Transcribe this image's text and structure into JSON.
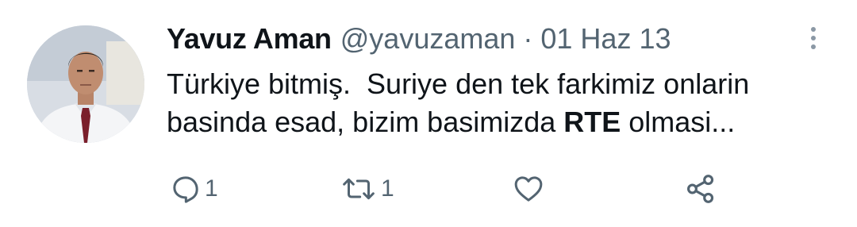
{
  "tweet": {
    "author": {
      "display_name": "Yavuz Aman",
      "handle": "@yavuzaman"
    },
    "separator": "·",
    "date": "01 Haz 13",
    "text": {
      "line1": "Türkiye bitmiş.  Suriye den tek farkimiz onlarin",
      "line2_before": "basinda esad, bizim basimizda ",
      "line2_bold": "RTE",
      "line2_after": " olmasi..."
    },
    "actions": {
      "reply": {
        "icon": "reply-icon",
        "count": "1"
      },
      "retweet": {
        "icon": "retweet-icon",
        "count": "1"
      },
      "like": {
        "icon": "heart-icon",
        "count": ""
      },
      "share": {
        "icon": "share-icon"
      }
    }
  },
  "colors": {
    "text_primary": "#0f1419",
    "text_secondary": "#536471",
    "background": "#ffffff"
  }
}
